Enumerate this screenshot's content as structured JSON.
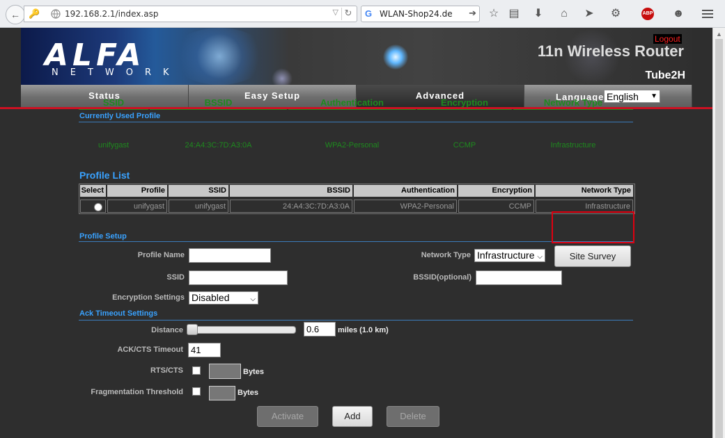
{
  "browser": {
    "url": "192.168.2.1/index.asp",
    "search_value": "WLAN-Shop24.de",
    "abp_label": "ABP"
  },
  "header": {
    "logo_text": "ALFA",
    "logo_subtext": "NETWORK",
    "logout_label": "Logout",
    "title": "11n Wireless Router",
    "model": "Tube2H"
  },
  "tabs": [
    {
      "label": "Status"
    },
    {
      "label": "Easy Setup"
    },
    {
      "label": "Advanced"
    }
  ],
  "language": {
    "label": "Language",
    "selected": "English"
  },
  "current_profile": {
    "title": "Currently Used Profile",
    "headers": [
      "SSID",
      "BSSID",
      "Authentication",
      "Encryption",
      "Network Type"
    ],
    "values": [
      "unifygast",
      "24:A4:3C:7D:A3:0A",
      "WPA2-Personal",
      "CCMP",
      "Infrastructure"
    ]
  },
  "profile_list": {
    "title": "Profile List",
    "headers": [
      "Select",
      "Profile",
      "SSID",
      "BSSID",
      "Authentication",
      "Encryption",
      "Network Type"
    ],
    "row": [
      "unifygast",
      "unifygast",
      "24:A4:3C:7D:A3:0A",
      "WPA2-Personal",
      "CCMP",
      "Infrastructure"
    ]
  },
  "profile_setup": {
    "title": "Profile Setup",
    "profile_name_label": "Profile Name",
    "profile_name_value": "",
    "ssid_label": "SSID",
    "ssid_value": "",
    "encryption_label": "Encryption Settings",
    "encryption_selected": "Disabled",
    "network_type_label": "Network Type",
    "network_type_selected": "Infrastructure",
    "site_survey_label": "Site Survey",
    "bssid_label": "BSSID(optional)",
    "bssid_value": ""
  },
  "ack_timeout": {
    "title": "Ack Timeout Settings",
    "distance_label": "Distance",
    "distance_value": "0.6",
    "distance_unit": "miles (1.0 km)",
    "ack_cts_label": "ACK/CTS Timeout",
    "ack_cts_value": "41",
    "rts_cts_label": "RTS/CTS",
    "rts_unit": "Bytes",
    "frag_label": "Fragmentation Threshold",
    "frag_unit": "Bytes"
  },
  "actions": {
    "activate": "Activate",
    "add": "Add",
    "delete": "Delete"
  },
  "colors": {
    "accent_blue": "#39a2ff",
    "current_profile_green": "#1e8a1e",
    "header_red_line": "#cc1122",
    "highlight_red": "#e00010"
  }
}
